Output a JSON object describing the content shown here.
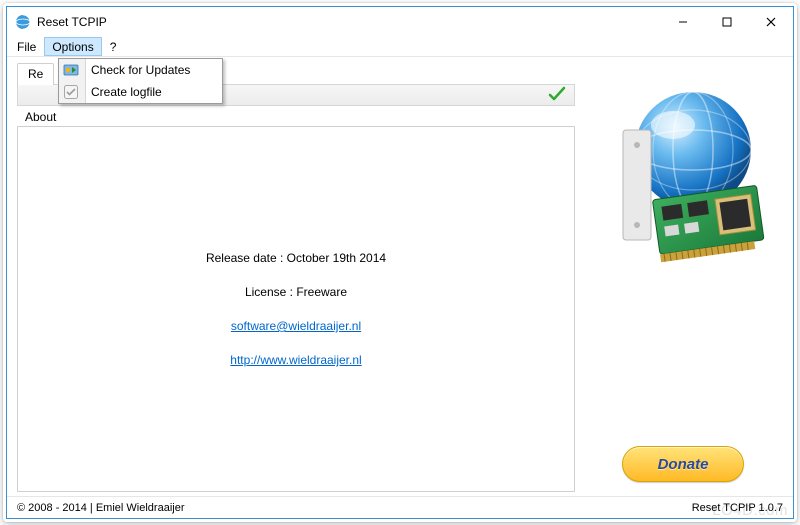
{
  "title_bar": {
    "title": "Reset TCPIP"
  },
  "win_controls": {
    "min": "–",
    "max": "☐",
    "close": "✕"
  },
  "menu": {
    "items": [
      "File",
      "Options",
      "?"
    ],
    "active_index": 1
  },
  "dropdown": {
    "items": [
      {
        "label": "Check for Updates",
        "icon": "updates-icon"
      },
      {
        "label": "Create logfile",
        "icon": "checkbox-icon"
      }
    ]
  },
  "tabs": {
    "hidden_tab": "Re",
    "active_tab": "About"
  },
  "about": {
    "release_line": "Release date : October 19th 2014",
    "license_line": "License : Freeware",
    "email": "software@wieldraaijer.nl",
    "url": "http://www.wieldraaijer.nl"
  },
  "donate_label": "Donate",
  "status": {
    "left": "© 2008 - 2014 | Emiel Wieldraaijer",
    "right": "Reset TCPIP 1.0.7"
  },
  "watermark": "LO4D.com"
}
